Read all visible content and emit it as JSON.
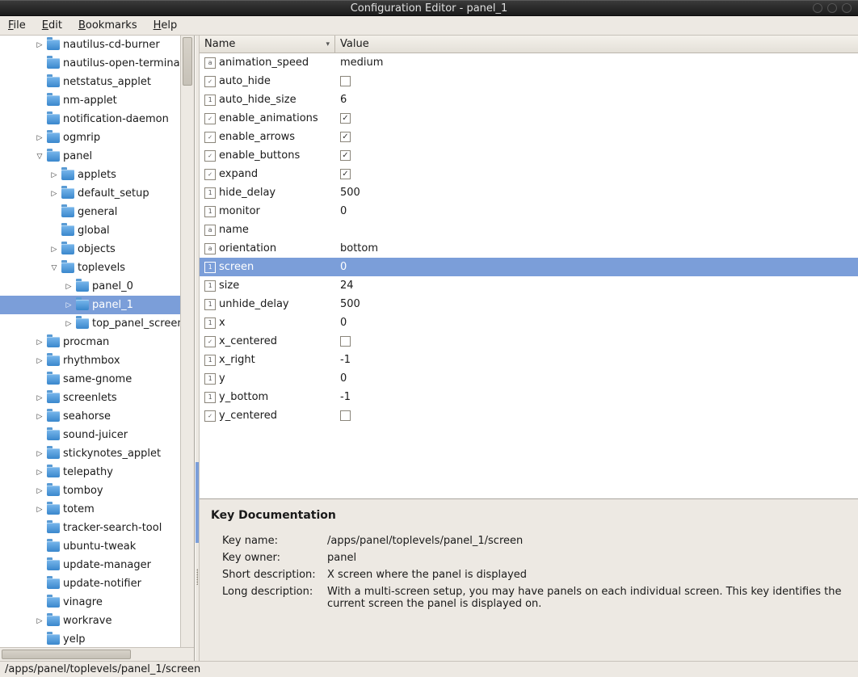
{
  "window": {
    "title": "Configuration Editor - panel_1"
  },
  "menubar": [
    {
      "label": "File",
      "mnemonic": "F"
    },
    {
      "label": "Edit",
      "mnemonic": "E"
    },
    {
      "label": "Bookmarks",
      "mnemonic": "B"
    },
    {
      "label": "Help",
      "mnemonic": "H"
    }
  ],
  "tree": [
    {
      "level": 2,
      "exp": ">",
      "label": "nautilus-cd-burner"
    },
    {
      "level": 2,
      "exp": "",
      "label": "nautilus-open-terminal"
    },
    {
      "level": 2,
      "exp": "",
      "label": "netstatus_applet"
    },
    {
      "level": 2,
      "exp": "",
      "label": "nm-applet"
    },
    {
      "level": 2,
      "exp": "",
      "label": "notification-daemon"
    },
    {
      "level": 2,
      "exp": ">",
      "label": "ogmrip"
    },
    {
      "level": 2,
      "exp": "v",
      "label": "panel"
    },
    {
      "level": 3,
      "exp": ">",
      "label": "applets"
    },
    {
      "level": 3,
      "exp": ">",
      "label": "default_setup"
    },
    {
      "level": 3,
      "exp": "",
      "label": "general"
    },
    {
      "level": 3,
      "exp": "",
      "label": "global"
    },
    {
      "level": 3,
      "exp": ">",
      "label": "objects"
    },
    {
      "level": 3,
      "exp": "v",
      "label": "toplevels"
    },
    {
      "level": 4,
      "exp": ">",
      "label": "panel_0"
    },
    {
      "level": 4,
      "exp": ">",
      "label": "panel_1",
      "selected": true
    },
    {
      "level": 4,
      "exp": ">",
      "label": "top_panel_screen"
    },
    {
      "level": 2,
      "exp": ">",
      "label": "procman"
    },
    {
      "level": 2,
      "exp": ">",
      "label": "rhythmbox"
    },
    {
      "level": 2,
      "exp": "",
      "label": "same-gnome"
    },
    {
      "level": 2,
      "exp": ">",
      "label": "screenlets"
    },
    {
      "level": 2,
      "exp": ">",
      "label": "seahorse"
    },
    {
      "level": 2,
      "exp": "",
      "label": "sound-juicer"
    },
    {
      "level": 2,
      "exp": ">",
      "label": "stickynotes_applet"
    },
    {
      "level": 2,
      "exp": ">",
      "label": "telepathy"
    },
    {
      "level": 2,
      "exp": ">",
      "label": "tomboy"
    },
    {
      "level": 2,
      "exp": ">",
      "label": "totem"
    },
    {
      "level": 2,
      "exp": "",
      "label": "tracker-search-tool"
    },
    {
      "level": 2,
      "exp": "",
      "label": "ubuntu-tweak"
    },
    {
      "level": 2,
      "exp": "",
      "label": "update-manager"
    },
    {
      "level": 2,
      "exp": "",
      "label": "update-notifier"
    },
    {
      "level": 2,
      "exp": "",
      "label": "vinagre"
    },
    {
      "level": 2,
      "exp": ">",
      "label": "workrave"
    },
    {
      "level": 2,
      "exp": "",
      "label": "yelp"
    }
  ],
  "columns": {
    "name": "Name",
    "value": "Value"
  },
  "keys": [
    {
      "type": "str",
      "name": "animation_speed",
      "value": "medium"
    },
    {
      "type": "bool",
      "name": "auto_hide",
      "checked": false
    },
    {
      "type": "int",
      "name": "auto_hide_size",
      "value": "6"
    },
    {
      "type": "bool",
      "name": "enable_animations",
      "checked": true
    },
    {
      "type": "bool",
      "name": "enable_arrows",
      "checked": true
    },
    {
      "type": "bool",
      "name": "enable_buttons",
      "checked": true
    },
    {
      "type": "bool",
      "name": "expand",
      "checked": true
    },
    {
      "type": "int",
      "name": "hide_delay",
      "value": "500"
    },
    {
      "type": "int",
      "name": "monitor",
      "value": "0"
    },
    {
      "type": "str",
      "name": "name",
      "value": ""
    },
    {
      "type": "str",
      "name": "orientation",
      "value": "bottom"
    },
    {
      "type": "int",
      "name": "screen",
      "value": "0",
      "selected": true
    },
    {
      "type": "int",
      "name": "size",
      "value": "24"
    },
    {
      "type": "int",
      "name": "unhide_delay",
      "value": "500"
    },
    {
      "type": "int",
      "name": "x",
      "value": "0"
    },
    {
      "type": "bool",
      "name": "x_centered",
      "checked": false
    },
    {
      "type": "int",
      "name": "x_right",
      "value": "-1"
    },
    {
      "type": "int",
      "name": "y",
      "value": "0"
    },
    {
      "type": "int",
      "name": "y_bottom",
      "value": "-1"
    },
    {
      "type": "bool",
      "name": "y_centered",
      "checked": false
    }
  ],
  "doc": {
    "heading": "Key Documentation",
    "labels": {
      "key_name": "Key name:",
      "key_owner": "Key owner:",
      "short_desc": "Short description:",
      "long_desc": "Long description:"
    },
    "key_name": "/apps/panel/toplevels/panel_1/screen",
    "key_owner": "panel",
    "short_desc": "X screen where the panel is displayed",
    "long_desc": "With a multi-screen setup, you may have panels on each individual screen. This key identifies the current screen the panel is displayed on."
  },
  "statusbar": "/apps/panel/toplevels/panel_1/screen"
}
